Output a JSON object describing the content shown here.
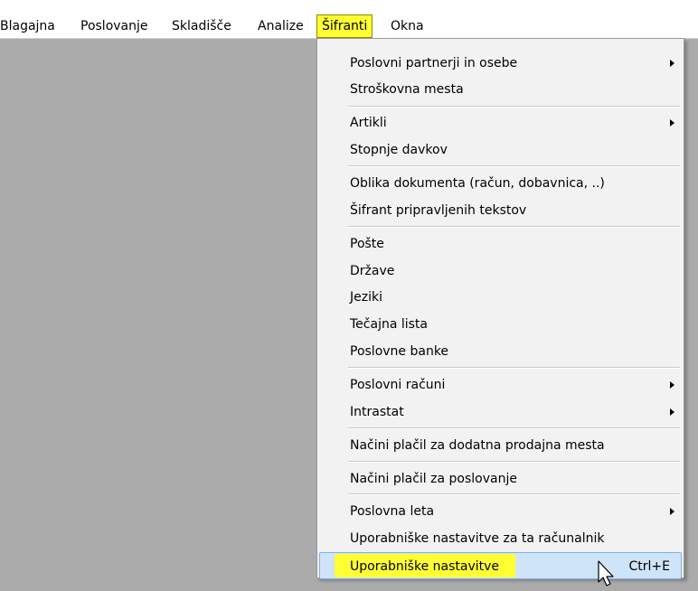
{
  "menubar": {
    "items": [
      {
        "label": "Blagajna"
      },
      {
        "label": "Poslovanje"
      },
      {
        "label": "Skladišče"
      },
      {
        "label": "Analize"
      },
      {
        "label": "Šifranti"
      },
      {
        "label": "Okna"
      }
    ]
  },
  "dropdown": {
    "items": [
      {
        "label": "Poslovni partnerji in osebe",
        "submenu": true
      },
      {
        "label": "Stroškovna mesta"
      },
      {
        "label": "Artikli",
        "submenu": true
      },
      {
        "label": "Stopnje davkov"
      },
      {
        "label": "Oblika dokumenta (račun, dobavnica, ..)"
      },
      {
        "label": "Šifrant pripravljenih tekstov"
      },
      {
        "label": "Pošte"
      },
      {
        "label": "Države"
      },
      {
        "label": "Jeziki"
      },
      {
        "label": "Tečajna lista"
      },
      {
        "label": "Poslovne banke"
      },
      {
        "label": "Poslovni računi",
        "submenu": true
      },
      {
        "label": "Intrastat",
        "submenu": true
      },
      {
        "label": "Načini plačil za dodatna prodajna mesta"
      },
      {
        "label": "Načini plačil za poslovanje"
      },
      {
        "label": "Poslovna leta",
        "submenu": true
      },
      {
        "label": "Uporabniške nastavitve za ta računalnik"
      },
      {
        "label": "Uporabniške nastavitve",
        "shortcut": "Ctrl+E",
        "highlighted": true
      }
    ]
  },
  "colors": {
    "highlight_yellow": "#ffff33",
    "hover_blue": "#cfe3f9",
    "workspace_gray": "#ababab"
  },
  "icons": {
    "submenu": "triangle-right-icon",
    "cursor": "mouse-pointer-icon"
  }
}
